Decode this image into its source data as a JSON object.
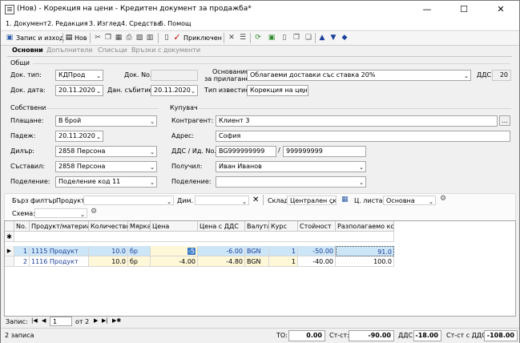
{
  "window": {
    "title": "(Нов) - Корекция на цени - Кредитен документ за продажба*",
    "minimize": "—",
    "maximize": "☐",
    "close": "✕"
  },
  "menu": [
    "1. Документ",
    "2. Редакция",
    "3. Изглед",
    "4. Средства",
    "5. Помощ"
  ],
  "toolbar": {
    "save_exit": "Запис и изход",
    "new": "Нов",
    "post": "Приключен"
  },
  "tabs": [
    "Основни",
    "Допълнители",
    "Списъци",
    "Връзки с документи"
  ],
  "general": {
    "section": "Общи",
    "doc_type_label": "Док. тип:",
    "doc_type": "КДПрод",
    "doc_no_label": "Док. No.",
    "doc_no": "",
    "doc_date_label": "Док. дата:",
    "doc_date": "20.11.2020",
    "tax_event_label": "Дан. събитие:",
    "tax_event": "20.11.2020",
    "basis_label_1": "Основание",
    "basis_label_2": "за прилагане:",
    "basis": "Облагаеми доставки със ставка 20%",
    "vat_label": "ДДС:",
    "vat": "20",
    "notice_type_label": "Тип известие:",
    "notice_type": "Корекция на цени"
  },
  "own": {
    "section": "Собствени",
    "payment_label": "Плащане:",
    "payment": "В брой",
    "due_label": "Падеж:",
    "due": "20.11.2020",
    "dealer_label": "Дилър:",
    "dealer": "2858 Персона",
    "author_label": "Съставил:",
    "author": "2858 Персона",
    "division_label": "Поделение:",
    "division": "Поделение код 11"
  },
  "buyer": {
    "section": "Купувач",
    "contragent_label": "Контрагент:",
    "contragent": "Клиент 3",
    "address_label": "Адрес:",
    "address": "София",
    "vat_id_label": "ДДС / Ид. No.",
    "vat_no": "BG999999999",
    "id_no": "999999999",
    "receiver_label": "Получил:",
    "receiver": "Иван Иванов",
    "division_label": "Поделение:",
    "division": "",
    "more_button": "..."
  },
  "filter": {
    "quick_filter": "Бърз филтър",
    "product_label": "Продукт:",
    "product": "",
    "dim_label": "Дим.",
    "dim": "",
    "warehouse_label": "Склад:",
    "warehouse": "Централен скл",
    "pricelist_label": "Ц. листа:",
    "pricelist": "Основна",
    "scheme_label": "Схема:",
    "scheme": ""
  },
  "grid": {
    "columns": [
      "No.",
      "Продукт/материал",
      "Количество",
      "Мярка",
      "Цена",
      "Цена с ДДС",
      "Валута",
      "Курс",
      "Стойност",
      "Разполагаемо кол."
    ],
    "rows": [
      {
        "no": "1",
        "product": "1115 Продукт",
        "qty": "10.0",
        "unit": "бр",
        "price": "",
        "price_vat": "-6.00",
        "currency": "BGN",
        "rate": "1",
        "value": "-50.00",
        "available": "91.0"
      },
      {
        "no": "2",
        "product": "1116 Продукт",
        "qty": "10.0",
        "unit": "бр",
        "price": "-4.00",
        "price_vat": "-4.80",
        "currency": "BGN",
        "rate": "1",
        "value": "-40.00",
        "available": "100.0"
      }
    ],
    "editing_value": "-5"
  },
  "nav": {
    "label": "Запис:",
    "current": "1",
    "of": "от 2"
  },
  "status": {
    "records": "2 записа",
    "to_label": "ТО:",
    "to": "0.00",
    "net_label": "Ст-ст:",
    "net": "-90.00",
    "vat_label": "ДДС:",
    "vat": "-18.00",
    "gross_label": "Ст-ст с ДДС:",
    "gross": "-108.00"
  },
  "colors": {
    "selected_row": "#cde6f7",
    "highlight_text": "#1a3e9a",
    "editing_cell": "#3d7cc9"
  }
}
